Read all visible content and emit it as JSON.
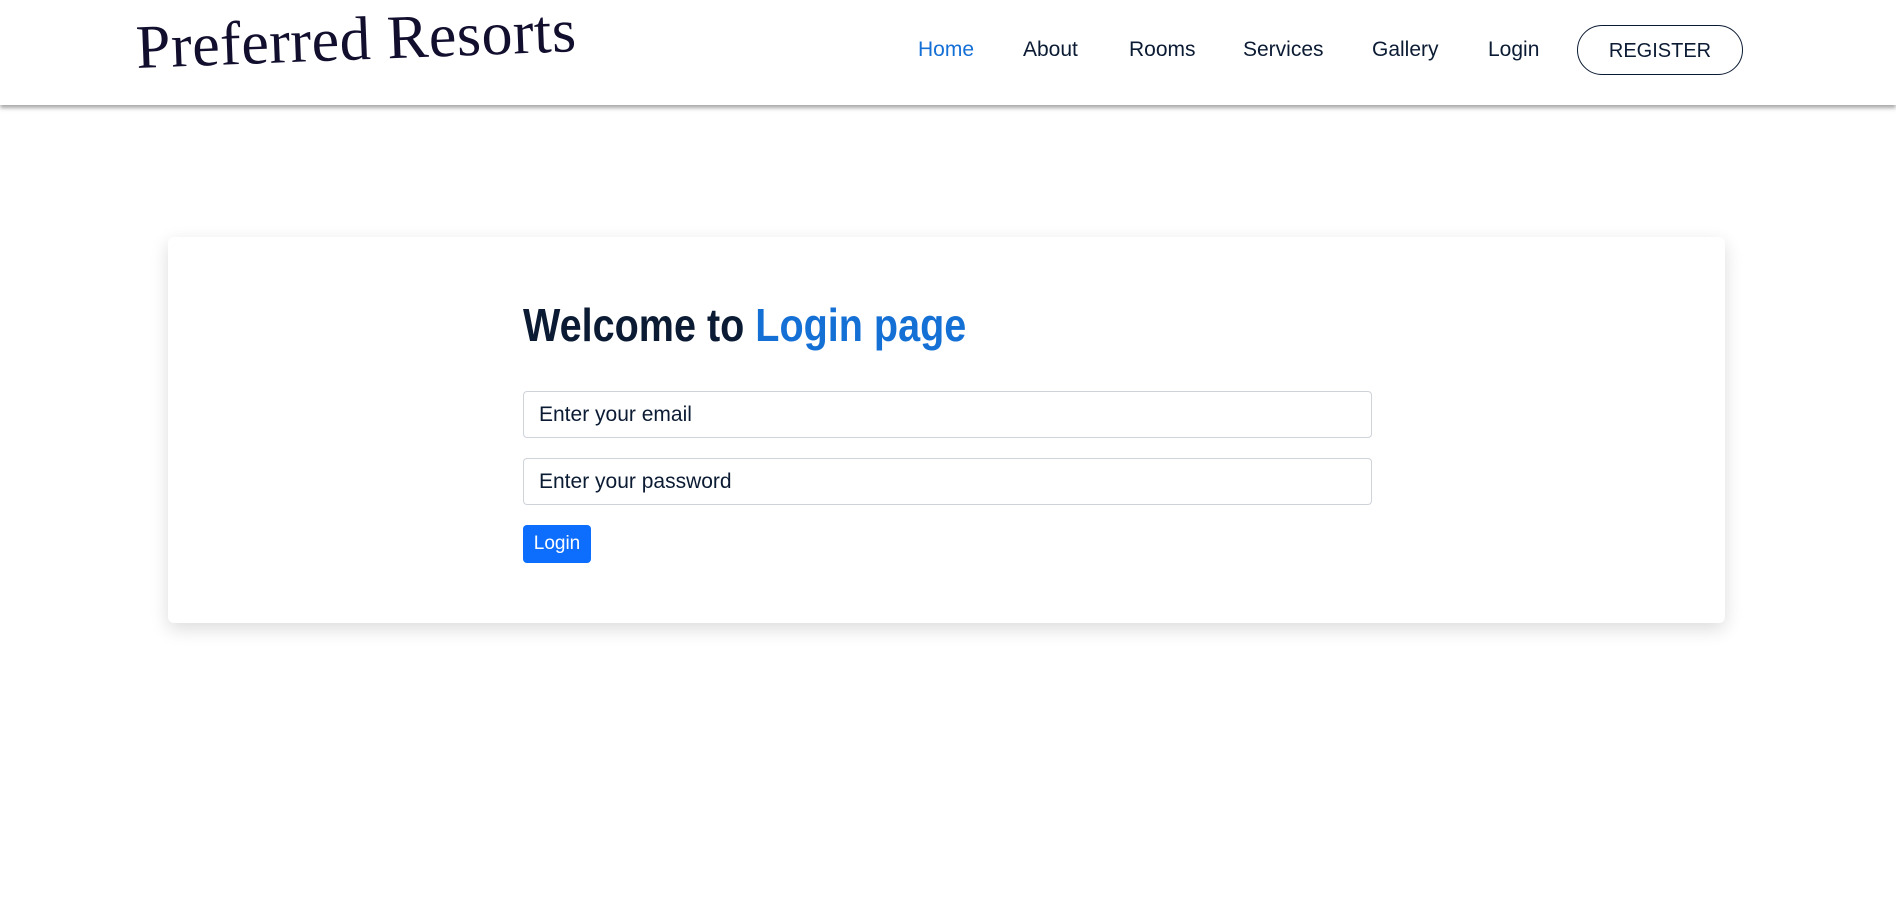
{
  "brand": {
    "name": "Preferred Resorts"
  },
  "nav": {
    "items": [
      {
        "label": "Home",
        "active": true
      },
      {
        "label": "About"
      },
      {
        "label": "Rooms"
      },
      {
        "label": "Services"
      },
      {
        "label": "Gallery"
      },
      {
        "label": "Login"
      }
    ],
    "register_label": "REGISTER"
  },
  "login": {
    "heading_prefix": "Welcome to",
    "heading_highlight": "Login page",
    "email_placeholder": "Enter your email",
    "password_placeholder": "Enter your password",
    "submit_label": "Login"
  },
  "colors": {
    "accent": "#1570d6",
    "primary_button": "#0d6efd",
    "text_dark": "#0b1b33"
  }
}
